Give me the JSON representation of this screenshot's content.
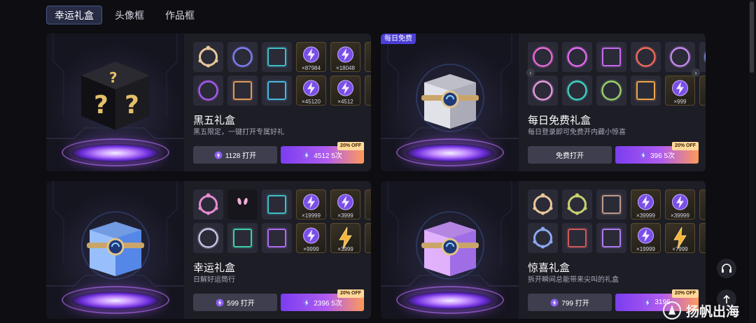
{
  "tabs": [
    {
      "label": "幸运礼盒",
      "active": true
    },
    {
      "label": "头像框",
      "active": false
    },
    {
      "label": "作品框",
      "active": false
    }
  ],
  "cards": [
    {
      "name": "黑五礼盒",
      "desc": "黑五限定，一键打开专属好礼",
      "badge": "",
      "single_label": "1128 打开",
      "multi_label": "4512 5次",
      "discount": "20% OFF",
      "box": "black",
      "items": [
        {
          "kind": "frame",
          "color": "#e8c79a",
          "qty": ""
        },
        {
          "kind": "ring",
          "color": "#7e7ef0",
          "qty": ""
        },
        {
          "kind": "square",
          "color": "#3fc0c8",
          "qty": ""
        },
        {
          "kind": "coin",
          "qty": "×87984"
        },
        {
          "kind": "coin",
          "qty": "×18048"
        },
        {
          "kind": "coin",
          "qty": ""
        },
        {
          "kind": "ring",
          "color": "#a85af0",
          "qty": ""
        },
        {
          "kind": "square",
          "color": "#e09a5a",
          "qty": ""
        },
        {
          "kind": "square",
          "color": "#49b8e0",
          "qty": ""
        },
        {
          "kind": "coin",
          "qty": "×45120"
        },
        {
          "kind": "coin",
          "qty": "×4512"
        },
        {
          "kind": "coin",
          "qty": ""
        }
      ]
    },
    {
      "name": "每日免费礼盒",
      "desc": "每日登录即可免费开内藏小惊喜",
      "badge": "每日免费",
      "single_label": "免费打开",
      "multi_label": "396 5次",
      "discount": "20% OFF",
      "box": "silver",
      "items": [
        {
          "kind": "ring",
          "color": "#e86ad8",
          "qty": ""
        },
        {
          "kind": "ring",
          "color": "#e26af0",
          "qty": ""
        },
        {
          "kind": "square",
          "color": "#c76af0",
          "qty": ""
        },
        {
          "kind": "ring",
          "color": "#f06a5a",
          "qty": ""
        },
        {
          "kind": "ring",
          "color": "#c68af0",
          "qty": ""
        },
        {
          "kind": "ring",
          "color": "#7a8af0",
          "qty": ""
        },
        {
          "kind": "ring",
          "color": "#e89adf",
          "qty": ""
        },
        {
          "kind": "ring",
          "color": "#3fd0c0",
          "qty": ""
        },
        {
          "kind": "ring",
          "color": "#9ad06a",
          "qty": ""
        },
        {
          "kind": "square",
          "color": "#f0a54a",
          "qty": ""
        },
        {
          "kind": "coin",
          "qty": "×999"
        },
        {
          "kind": "coin",
          "qty": ""
        }
      ]
    },
    {
      "name": "幸运礼盒",
      "desc": "日解好运筒行",
      "badge": "",
      "single_label": "599 打开",
      "multi_label": "2396 5次",
      "discount": "20% OFF",
      "box": "blue",
      "items": [
        {
          "kind": "frame",
          "color": "#e88ad0",
          "qty": ""
        },
        {
          "kind": "ears",
          "color": "#f0b0d8",
          "qty": ""
        },
        {
          "kind": "square",
          "color": "#3fc0c8",
          "qty": ""
        },
        {
          "kind": "coin",
          "qty": "×19999"
        },
        {
          "kind": "coin",
          "qty": "×3999"
        },
        {
          "kind": "coin",
          "qty": ""
        },
        {
          "kind": "ring",
          "color": "#c8c8e8",
          "qty": ""
        },
        {
          "kind": "square",
          "color": "#3fd0a8",
          "qty": ""
        },
        {
          "kind": "square",
          "color": "#b06af0",
          "qty": ""
        },
        {
          "kind": "coin",
          "qty": "×9999"
        },
        {
          "kind": "bolt",
          "qty": "×3999"
        },
        {
          "kind": "bolt",
          "qty": ""
        }
      ]
    },
    {
      "name": "惊喜礼盒",
      "desc": "拆开瞬间总能带来尖叫的礼盒",
      "badge": "",
      "single_label": "799 打开",
      "multi_label": "3196",
      "discount": "20% OFF",
      "box": "pink",
      "items": [
        {
          "kind": "frame",
          "color": "#e8c79a",
          "qty": ""
        },
        {
          "kind": "frame",
          "color": "#c8d070",
          "qty": ""
        },
        {
          "kind": "square",
          "color": "#c09a8a",
          "qty": ""
        },
        {
          "kind": "coin",
          "qty": "×39999"
        },
        {
          "kind": "coin",
          "qty": "×39999"
        },
        {
          "kind": "coin",
          "qty": ""
        },
        {
          "kind": "frame",
          "color": "#8aa8f0",
          "qty": ""
        },
        {
          "kind": "square",
          "color": "#d05a5a",
          "qty": ""
        },
        {
          "kind": "square",
          "color": "#b07af0",
          "qty": ""
        },
        {
          "kind": "coin",
          "qty": "×19999"
        },
        {
          "kind": "bolt",
          "qty": "×7999"
        },
        {
          "kind": "bolt",
          "qty": ""
        }
      ]
    }
  ],
  "watermark": "扬帆出海",
  "colors": {
    "accent": "#7a3df0",
    "tab_active_bg": "#272c44",
    "card_bg": "#1d1d26"
  }
}
